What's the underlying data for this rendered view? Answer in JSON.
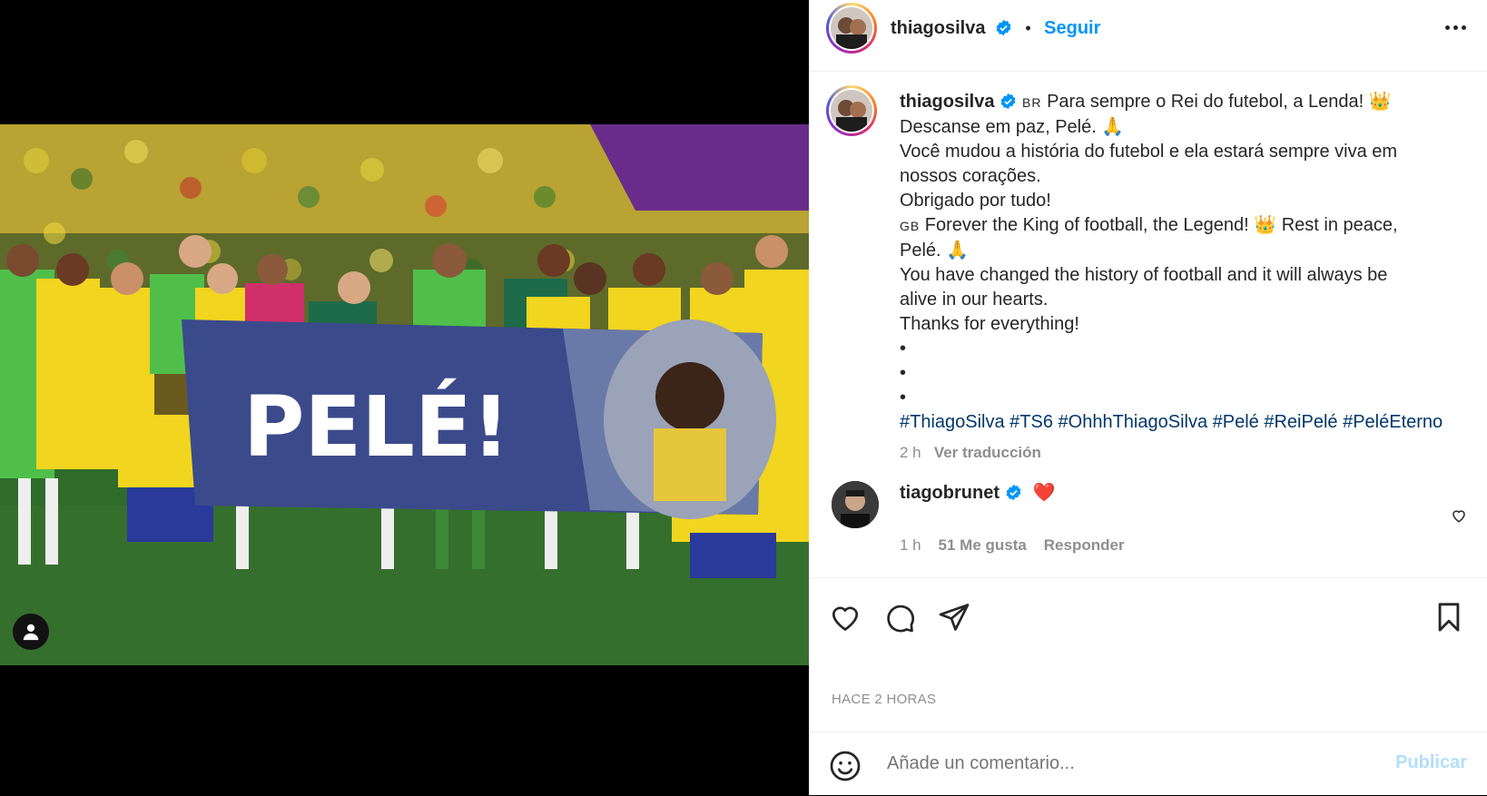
{
  "post": {
    "author": "thiagosilva",
    "follow_label": "Seguir",
    "separator": "•",
    "banner_text": "PELÉ!",
    "time_label": "HACE 2 HORAS"
  },
  "caption": {
    "flag_br": "BR",
    "line1": "Para sempre o Rei do futebol, a Lenda! 👑",
    "line2": "Descanse em paz, Pelé. 🙏",
    "line3": "Você mudou a história do futebol e ela estará sempre viva em",
    "line4": "nossos corações.",
    "line5": "Obrigado por tudo!",
    "flag_gb": "GB",
    "line6": "Forever the King of football, the Legend! 👑 Rest in peace,",
    "line7": "Pelé. 🙏",
    "line8": "You have changed the history of football and it will always be",
    "line9": "alive in our hearts.",
    "line10": "Thanks for everything!",
    "bullet": "•",
    "hashtags": "#ThiagoSilva #TS6 #OhhhThiagoSilva #Pelé #ReiPelé #PeléEterno",
    "time": "2 h",
    "translate": "Ver traducción"
  },
  "comment": {
    "author": "tiagobrunet",
    "emoji": "❤️",
    "time": "1 h",
    "likes": "51 Me gusta",
    "reply": "Responder"
  },
  "add_comment": {
    "placeholder": "Añade un comentario...",
    "publish": "Publicar"
  },
  "colors": {
    "accent": "#0095f6",
    "banner": "#3b4a8a",
    "pitch": "#2f6b2a"
  },
  "icons": [
    "verified-badge-icon",
    "more-options-icon",
    "heart-icon",
    "comment-icon",
    "share-icon",
    "bookmark-icon",
    "emoji-icon",
    "user-tag-icon"
  ]
}
